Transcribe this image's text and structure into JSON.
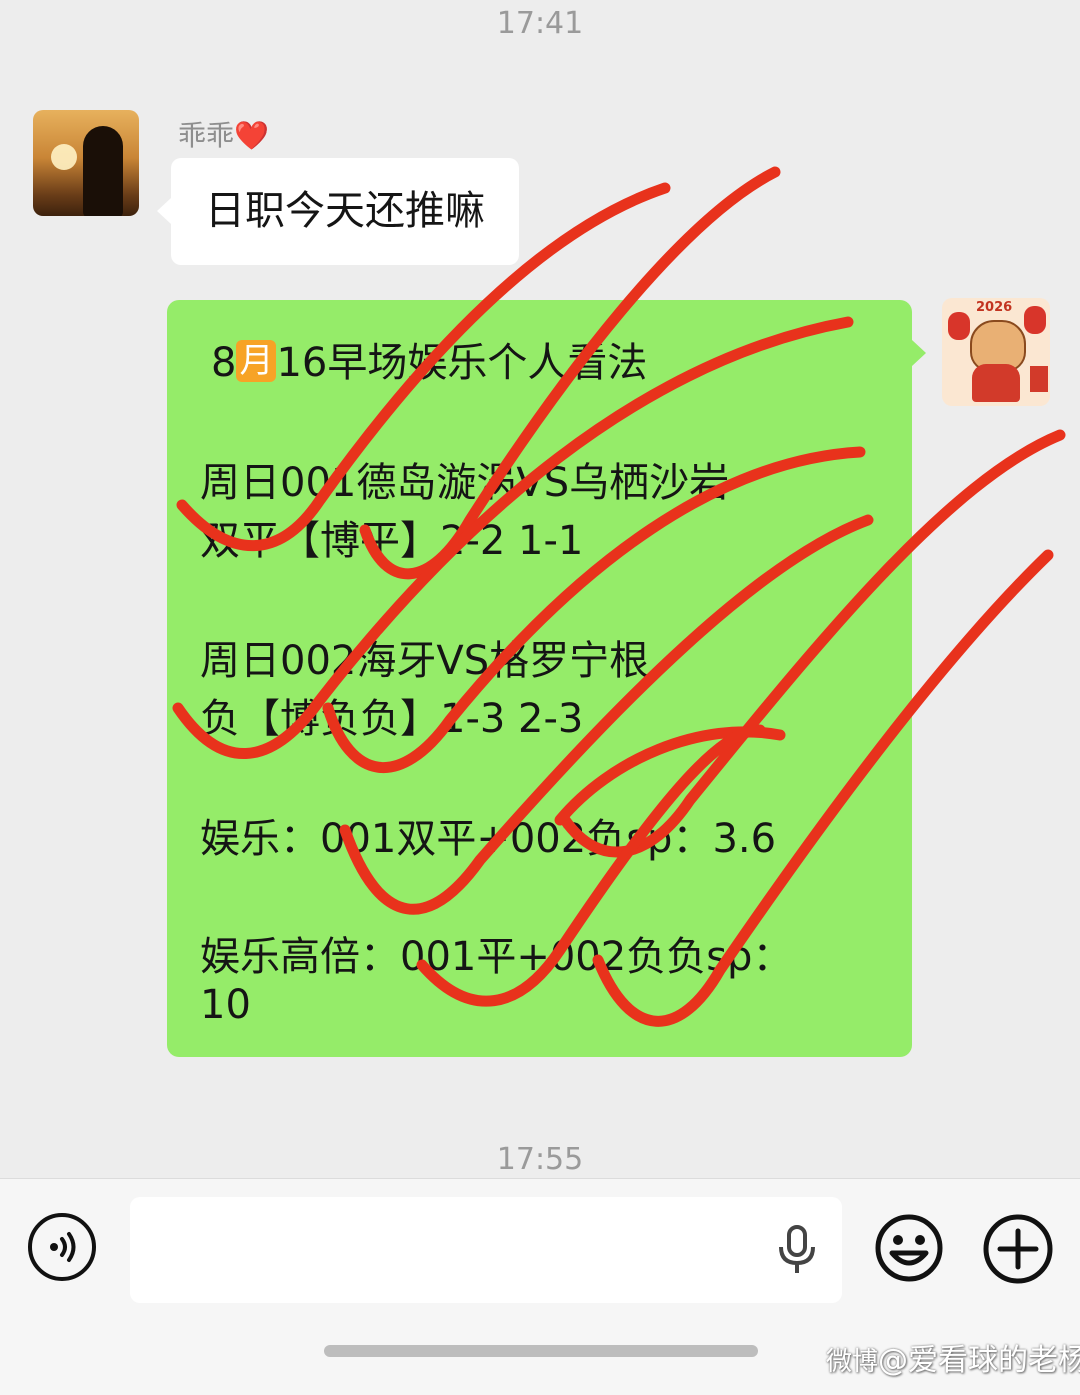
{
  "chat": {
    "timestamp_top": "17:41",
    "timestamp_bottom": "17:55",
    "incoming": {
      "sender_name": "乖乖",
      "sender_emoji": "❤️",
      "text": "日职今天还推嘛"
    },
    "outgoing": {
      "title_prefix": "8",
      "title_month_badge": "月",
      "title_suffix": "16早场娱乐个人看法",
      "lines": [
        "周日001德岛漩涡VS乌栖沙岩",
        "双平【博平】2-2 1-1",
        "周日002海牙VS格罗宁根",
        "负【博负负】1-3 2-3",
        "娱乐：001双平+002负sp：3.6",
        "娱乐高倍：001平+002负负sp：",
        "10"
      ],
      "avatar_year": "2026",
      "avatar_char": "福"
    },
    "annotation_color": "#e8321c"
  },
  "input_bar": {
    "text_value": "",
    "voice_icon": "voice-icon",
    "mic_icon": "microphone-icon",
    "emoji_icon": "emoji-icon",
    "plus_icon": "plus-icon"
  },
  "watermark": {
    "logo": "微博",
    "text": "@爱看球的老杨"
  }
}
